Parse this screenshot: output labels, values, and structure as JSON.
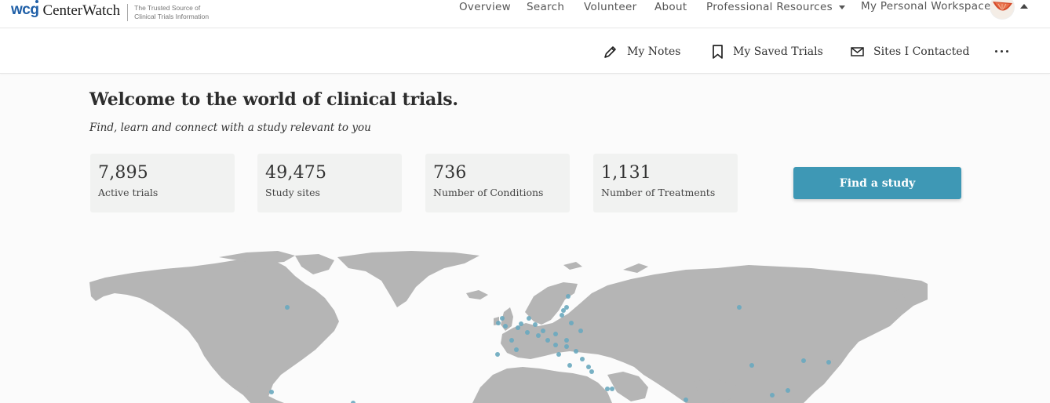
{
  "brand": {
    "wcg": "wcg",
    "name": "CenterWatch",
    "tagline_line1": "The Trusted Source of",
    "tagline_line2": "Clinical Trials Information",
    "color": "#1f5fa7"
  },
  "nav": {
    "overview": "Overview",
    "search": "Search",
    "volunteer": "Volunteer",
    "about": "About",
    "professional_resources": "Professional Resources",
    "workspace": "My Personal Workspace"
  },
  "subnav": {
    "notes": "My Notes",
    "saved": "My Saved Trials",
    "contacted": "Sites I Contacted",
    "icons": [
      "pencil-icon",
      "bookmark-icon",
      "envelope-icon",
      "more-icon"
    ]
  },
  "hero": {
    "title": "Welcome to the world of clinical trials.",
    "subtitle": "Find, learn and connect with a study relevant to you"
  },
  "stats": [
    {
      "value": "7,895",
      "label": "Active trials"
    },
    {
      "value": "49,475",
      "label": "Study sites"
    },
    {
      "value": "736",
      "label": "Number of Conditions"
    },
    {
      "value": "1,131",
      "label": "Number of Treatments"
    }
  ],
  "cta": {
    "label": "Find a study",
    "color": "#3e98b5"
  },
  "map": {
    "land_color": "#b5b5b5",
    "site_dot_color": "#6aa9bf"
  }
}
